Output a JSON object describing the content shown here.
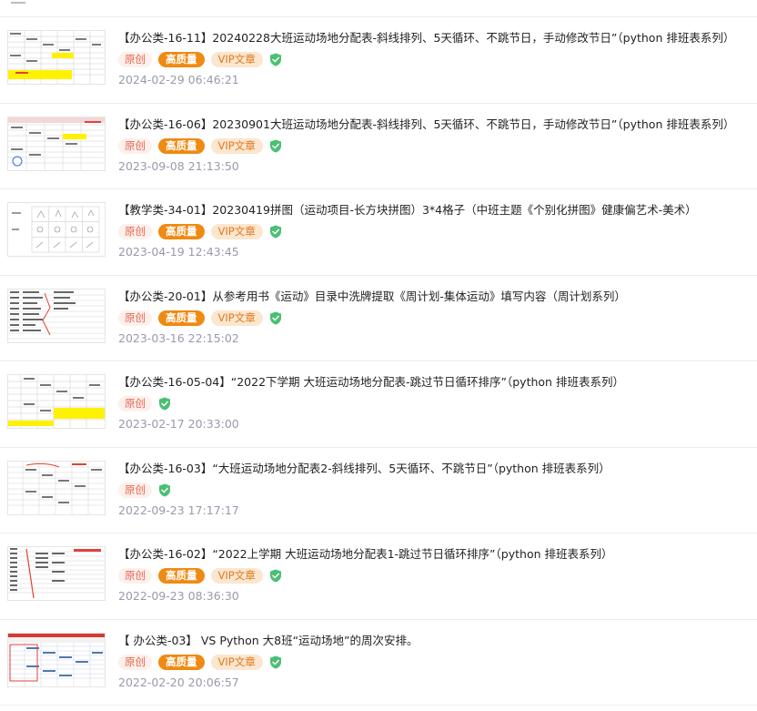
{
  "articles": [
    {
      "title": "【办公类-16-11】20240228大班运动场地分配表-斜线排列、5天循环、不跳节日，手动修改节日”（python 排班表系列）",
      "tags": {
        "original": "原创",
        "quality": "高质量",
        "vip": "VIP文章"
      },
      "verified": true,
      "date": "2024-02-29 06:46:21",
      "thumbnail_icon": "spreadsheet-yellow-highlight-thumbnail"
    },
    {
      "title": "【办公类-16-06】20230901大班运动场地分配表-斜线排列、5天循环、不跳节日，手动修改节日”（python 排班表系列）",
      "tags": {
        "original": "原创",
        "quality": "高质量",
        "vip": "VIP文章"
      },
      "verified": true,
      "date": "2023-09-08 21:13:50",
      "thumbnail_icon": "spreadsheet-thumbnail"
    },
    {
      "title": "【教学类-34-01】20230419拼图（运动项目-长方块拼图）3*4格子（中班主题《个别化拼图》健康偏艺术-美术）",
      "tags": {
        "original": "原创",
        "quality": "高质量",
        "vip": "VIP文章"
      },
      "verified": true,
      "date": "2023-04-19 12:43:45",
      "thumbnail_icon": "puzzle-grid-thumbnail"
    },
    {
      "title": "【办公类-20-01】从参考用书《运动》目录中洗牌提取《周计划-集体运动》填写内容（周计划系列）",
      "tags": {
        "original": "原创",
        "quality": "高质量",
        "vip": "VIP文章"
      },
      "verified": true,
      "date": "2023-03-16 22:15:02",
      "thumbnail_icon": "list-sheet-thumbnail"
    },
    {
      "title": "【办公类-16-05-04】“2022下学期 大班运动场地分配表-跳过节日循环排序”（python 排班表系列）",
      "tags": {
        "original": "原创"
      },
      "verified": true,
      "date": "2023-02-17 20:33:00",
      "thumbnail_icon": "spreadsheet-yellow-thumbnail"
    },
    {
      "title": "【办公类-16-03】“大班运动场地分配表2-斜线排列、5天循环、不跳节日”（python 排班表系列）",
      "tags": {
        "original": "原创"
      },
      "verified": true,
      "date": "2022-09-23 17:17:17",
      "thumbnail_icon": "spreadsheet-red-marks-thumbnail"
    },
    {
      "title": "【办公类-16-02】“2022上学期 大班运动场地分配表1-跳过节日循环排序”（python 排班表系列）",
      "tags": {
        "original": "原创",
        "quality": "高质量",
        "vip": "VIP文章"
      },
      "verified": true,
      "date": "2022-09-23 08:36:30",
      "thumbnail_icon": "spreadsheet-red-line-thumbnail"
    },
    {
      "title": "【 办公类-03】 VS Python 大8班“运动场地”的周次安排。",
      "tags": {
        "original": "原创",
        "quality": "高质量",
        "vip": "VIP文章"
      },
      "verified": true,
      "date": "2022-02-20 20:06:57",
      "thumbnail_icon": "excel-window-thumbnail"
    }
  ],
  "colors": {
    "original_bg": "#fdf0ec",
    "original_fg": "#e8654f",
    "quality_bg": "#ef8a12",
    "vip_bg": "#fbe6cf",
    "vip_fg": "#e07a1f",
    "verified": "#4bbf73",
    "date": "#999aaa"
  }
}
